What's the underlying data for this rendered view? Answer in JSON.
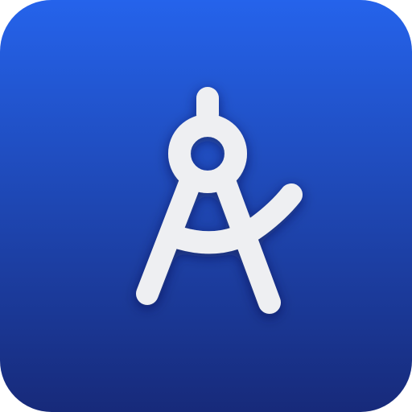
{
  "app_icon": {
    "glyph": "drafting-compass-icon",
    "colors": {
      "gradient_top": "#2563EB",
      "gradient_bottom": "#172A7A",
      "glyph": "#EEEFF2",
      "glyph_shadow": "#0A1440"
    }
  }
}
